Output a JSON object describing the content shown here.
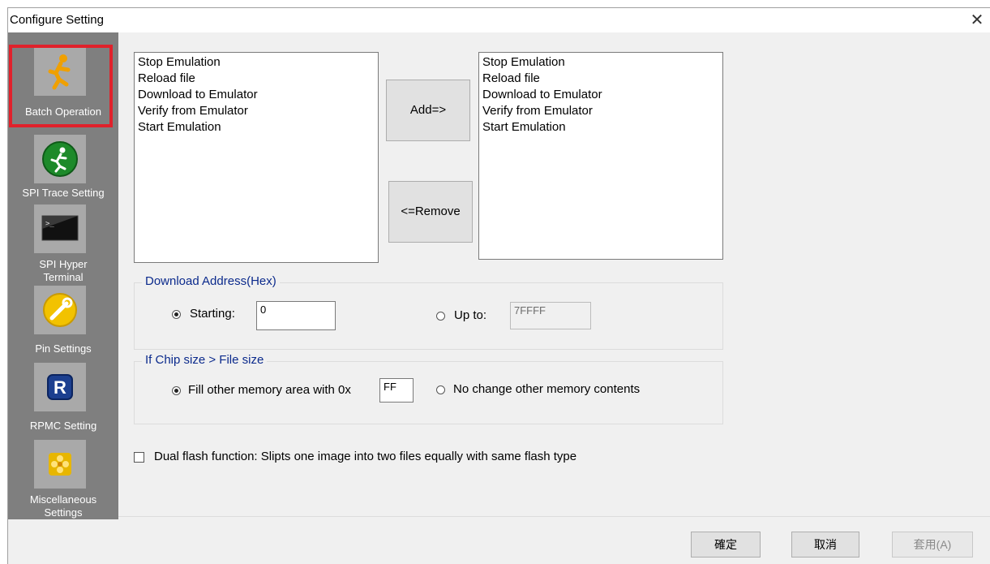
{
  "window": {
    "title": "Configure Setting",
    "close_glyph": "✕"
  },
  "sidebar": {
    "items": [
      {
        "label": "Batch Operation",
        "icon": "running-man-icon",
        "selected": true
      },
      {
        "label": "SPI Trace Setting",
        "icon": "green-runner-icon",
        "selected": false
      },
      {
        "label_line1": "SPI Hyper",
        "label_line2": "Terminal",
        "icon": "terminal-icon",
        "selected": false
      },
      {
        "label": "Pin Settings",
        "icon": "wrench-icon",
        "selected": false
      },
      {
        "label": "RPMC Setting",
        "icon": "r-badge-icon",
        "selected": false
      },
      {
        "label_line1": "Miscellaneous",
        "label_line2": "Settings",
        "icon": "flower-icon",
        "selected": false
      }
    ]
  },
  "source_list": {
    "items": [
      "Stop Emulation",
      "Reload file",
      "Download to Emulator",
      "Verify from Emulator",
      "Start Emulation"
    ]
  },
  "target_list": {
    "items": [
      "Stop Emulation",
      "Reload file",
      "Download to Emulator",
      "Verify from Emulator",
      "Start Emulation"
    ]
  },
  "buttons": {
    "add": "Add=>",
    "remove": "<=Remove"
  },
  "download_address": {
    "title": "Download Address(Hex)",
    "starting_label": "Starting:",
    "starting_value": "0",
    "starting_checked": true,
    "upto_label": "Up to:",
    "upto_value": "7FFFF",
    "upto_checked": false
  },
  "chip_size": {
    "title": "If Chip size > File size",
    "fill_label": "Fill other memory area with 0x",
    "fill_value": "FF",
    "fill_checked": true,
    "nochange_label": "No change other memory contents",
    "nochange_checked": false
  },
  "dual_flash": {
    "label": "Dual flash function:  Slipts one image into two files equally with same flash type",
    "checked": false
  },
  "dialog_buttons": {
    "ok": "確定",
    "cancel": "取消",
    "apply": "套用(A)"
  }
}
